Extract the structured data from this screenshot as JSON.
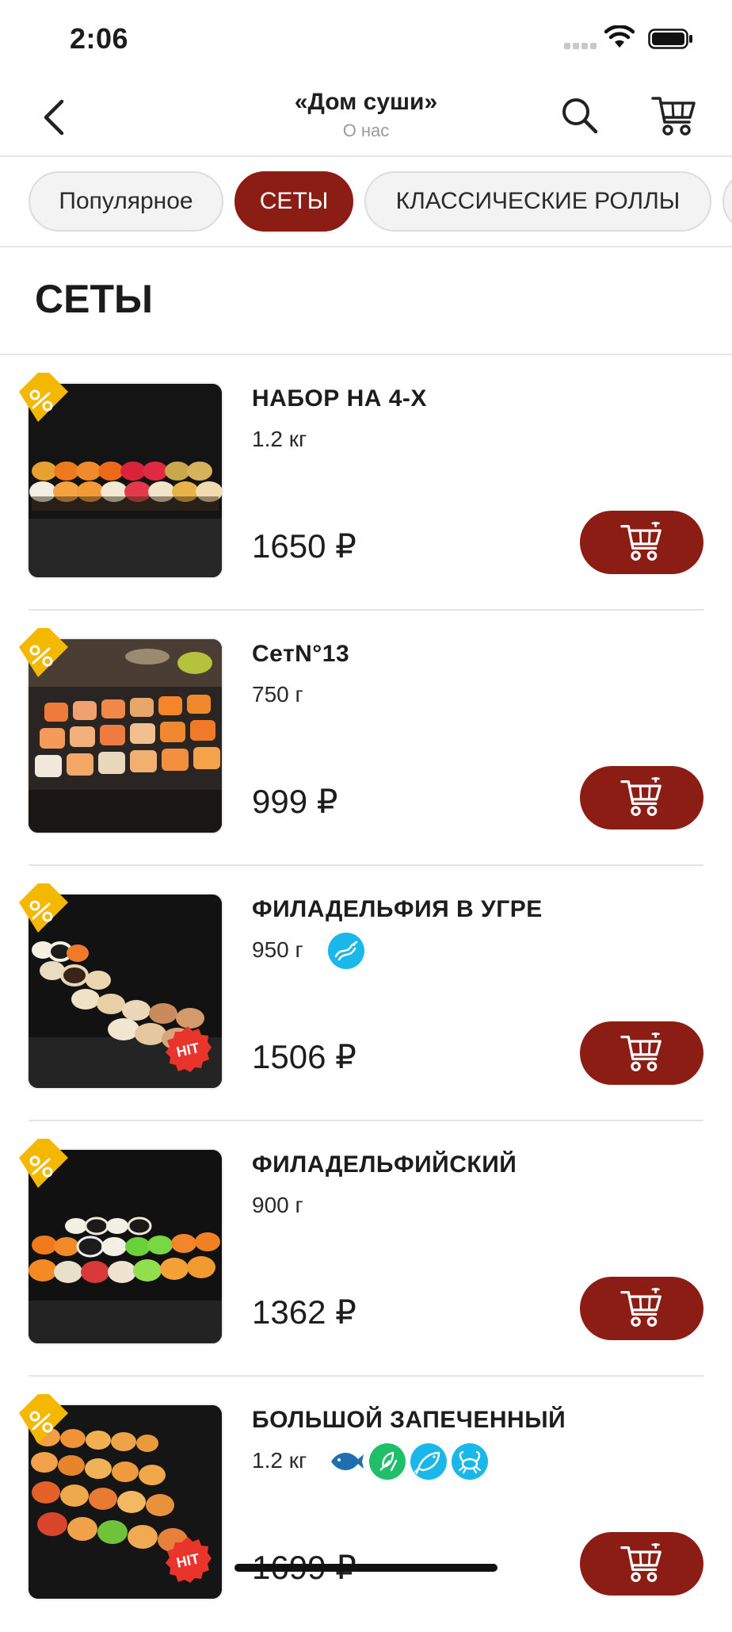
{
  "status": {
    "time": "2:06"
  },
  "header": {
    "title": "«Дом суши»",
    "subtitle": "О нас"
  },
  "categories": [
    {
      "label": "Популярное",
      "active": false
    },
    {
      "label": "СЕТЫ",
      "active": true
    },
    {
      "label": "КЛАССИЧЕСКИЕ РОЛЛЫ",
      "active": false
    }
  ],
  "section": {
    "title": "СЕТЫ"
  },
  "products": [
    {
      "name": "НАБОР НА 4-Х",
      "weight": "1.2 кг",
      "price": "1650 ₽",
      "discount": true,
      "hit": false,
      "badges": []
    },
    {
      "name": "СетN°13",
      "weight": "750 г",
      "price": "999 ₽",
      "discount": true,
      "hit": false,
      "badges": []
    },
    {
      "name": "ФИЛАДЕЛЬФИЯ В УГРЕ",
      "weight": "950 г",
      "price": "1506 ₽",
      "discount": true,
      "hit": true,
      "hit_label": "HIT",
      "badges": [
        "eel-icon"
      ]
    },
    {
      "name": "ФИЛАДЕЛЬФИЙСКИЙ",
      "weight": "900 г",
      "price": "1362 ₽",
      "discount": true,
      "hit": false,
      "badges": []
    },
    {
      "name": "БОЛЬШОЙ ЗАПЕЧЕННЫЙ",
      "weight": "1.2 кг",
      "price": "1699 ₽",
      "discount": true,
      "hit": true,
      "hit_label": "HIT",
      "badges": [
        "fish-icon",
        "vegetable-icon",
        "salmon-icon",
        "crab-icon"
      ]
    }
  ],
  "colors": {
    "accent": "#8c1d14",
    "discount_tag": "#f5b800",
    "hit_badge": "#e8342b",
    "badge_blue": "#1ab7ea",
    "badge_green": "#1fbf6a",
    "fish_blue": "#1e6fb0"
  }
}
